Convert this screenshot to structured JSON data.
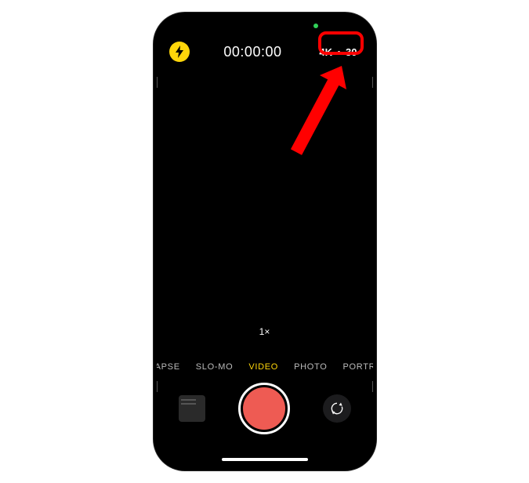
{
  "status": {
    "camera_indicator_color": "#30d158"
  },
  "topbar": {
    "flash_icon": "bolt-icon",
    "timer": "00:00:00",
    "format": {
      "resolution": "4K",
      "fps": "30"
    }
  },
  "zoom": {
    "label": "1×"
  },
  "modes": {
    "items": [
      "ME-LAPSE",
      "SLO-MO",
      "VIDEO",
      "PHOTO",
      "PORTRAIT"
    ],
    "active_index": 2
  },
  "controls": {
    "record_color": "#ee5b53",
    "flip_icon": "camera-flip-icon",
    "thumbnail_icon": "last-capture-thumbnail"
  },
  "annotation": {
    "highlight_target": "video-format-selector",
    "arrow_color": "#ff0000"
  }
}
